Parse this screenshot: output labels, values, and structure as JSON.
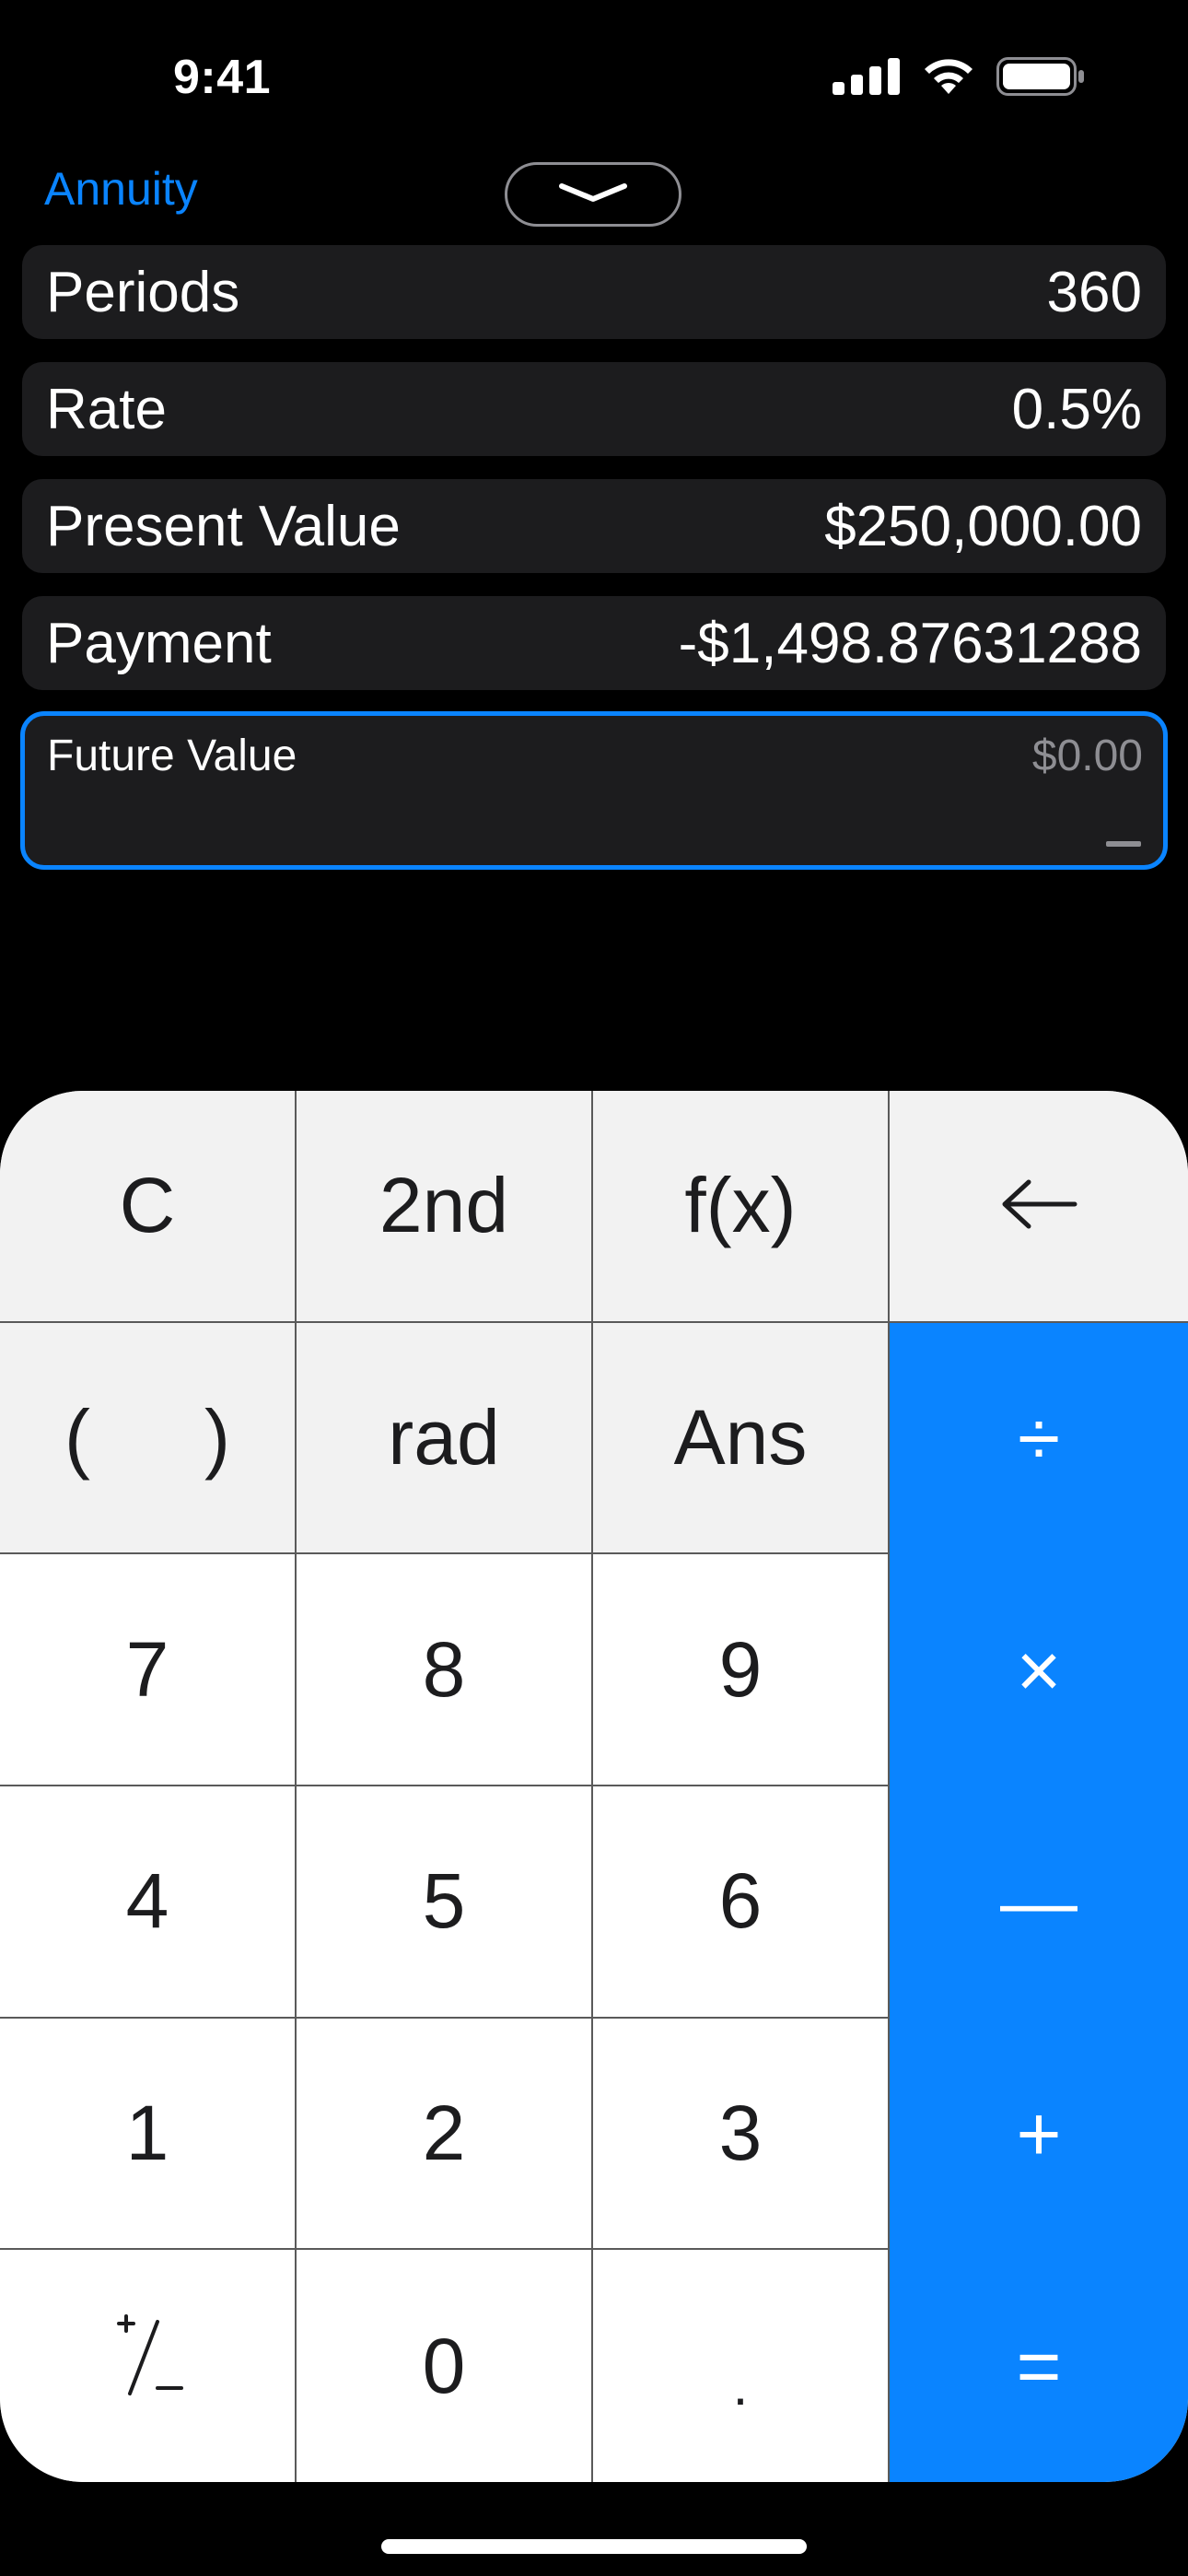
{
  "status_bar": {
    "time": "9:41"
  },
  "header": {
    "mode_label": "Annuity",
    "collapse_icon": "chevron-down-icon"
  },
  "fields": [
    {
      "label": "Periods",
      "value": "360"
    },
    {
      "label": "Rate",
      "value": "0.5%"
    },
    {
      "label": "Present Value",
      "value": "$250,000.00"
    },
    {
      "label": "Payment",
      "value": "-$1,498.87631288"
    }
  ],
  "active_field": {
    "label": "Future Value",
    "value": "$0.00"
  },
  "keypad": {
    "clear": "C",
    "second": "2nd",
    "function": "f(x)",
    "backspace_icon": "backspace-arrow-icon",
    "paren_open": "(",
    "paren_close": ")",
    "rad": "rad",
    "ans": "Ans",
    "divide": "÷",
    "multiply": "×",
    "minus": "—",
    "plus": "+",
    "equals": "=",
    "decimal": ".",
    "digits": {
      "d0": "0",
      "d1": "1",
      "d2": "2",
      "d3": "3",
      "d4": "4",
      "d5": "5",
      "d6": "6",
      "d7": "7",
      "d8": "8",
      "d9": "9"
    },
    "plus_minus_icon": "plus-minus-icon"
  },
  "colors": {
    "accent": "#0a84ff",
    "field_bg": "#1c1c1e",
    "key_top_bg": "#f2f2f2",
    "key_num_bg": "#ffffff",
    "key_op_bg": "#0a84ff"
  }
}
